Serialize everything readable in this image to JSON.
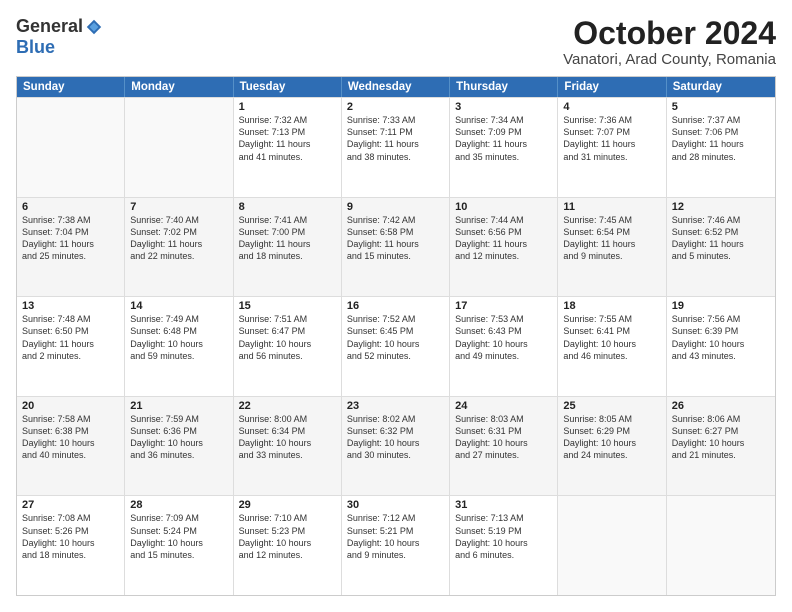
{
  "header": {
    "logo_general": "General",
    "logo_blue": "Blue",
    "month": "October 2024",
    "location": "Vanatori, Arad County, Romania"
  },
  "weekdays": [
    "Sunday",
    "Monday",
    "Tuesday",
    "Wednesday",
    "Thursday",
    "Friday",
    "Saturday"
  ],
  "rows": [
    [
      {
        "day": "",
        "lines": [],
        "empty": true
      },
      {
        "day": "",
        "lines": [],
        "empty": true
      },
      {
        "day": "1",
        "lines": [
          "Sunrise: 7:32 AM",
          "Sunset: 7:13 PM",
          "Daylight: 11 hours",
          "and 41 minutes."
        ]
      },
      {
        "day": "2",
        "lines": [
          "Sunrise: 7:33 AM",
          "Sunset: 7:11 PM",
          "Daylight: 11 hours",
          "and 38 minutes."
        ]
      },
      {
        "day": "3",
        "lines": [
          "Sunrise: 7:34 AM",
          "Sunset: 7:09 PM",
          "Daylight: 11 hours",
          "and 35 minutes."
        ]
      },
      {
        "day": "4",
        "lines": [
          "Sunrise: 7:36 AM",
          "Sunset: 7:07 PM",
          "Daylight: 11 hours",
          "and 31 minutes."
        ]
      },
      {
        "day": "5",
        "lines": [
          "Sunrise: 7:37 AM",
          "Sunset: 7:06 PM",
          "Daylight: 11 hours",
          "and 28 minutes."
        ]
      }
    ],
    [
      {
        "day": "6",
        "lines": [
          "Sunrise: 7:38 AM",
          "Sunset: 7:04 PM",
          "Daylight: 11 hours",
          "and 25 minutes."
        ]
      },
      {
        "day": "7",
        "lines": [
          "Sunrise: 7:40 AM",
          "Sunset: 7:02 PM",
          "Daylight: 11 hours",
          "and 22 minutes."
        ]
      },
      {
        "day": "8",
        "lines": [
          "Sunrise: 7:41 AM",
          "Sunset: 7:00 PM",
          "Daylight: 11 hours",
          "and 18 minutes."
        ]
      },
      {
        "day": "9",
        "lines": [
          "Sunrise: 7:42 AM",
          "Sunset: 6:58 PM",
          "Daylight: 11 hours",
          "and 15 minutes."
        ]
      },
      {
        "day": "10",
        "lines": [
          "Sunrise: 7:44 AM",
          "Sunset: 6:56 PM",
          "Daylight: 11 hours",
          "and 12 minutes."
        ]
      },
      {
        "day": "11",
        "lines": [
          "Sunrise: 7:45 AM",
          "Sunset: 6:54 PM",
          "Daylight: 11 hours",
          "and 9 minutes."
        ]
      },
      {
        "day": "12",
        "lines": [
          "Sunrise: 7:46 AM",
          "Sunset: 6:52 PM",
          "Daylight: 11 hours",
          "and 5 minutes."
        ]
      }
    ],
    [
      {
        "day": "13",
        "lines": [
          "Sunrise: 7:48 AM",
          "Sunset: 6:50 PM",
          "Daylight: 11 hours",
          "and 2 minutes."
        ]
      },
      {
        "day": "14",
        "lines": [
          "Sunrise: 7:49 AM",
          "Sunset: 6:48 PM",
          "Daylight: 10 hours",
          "and 59 minutes."
        ]
      },
      {
        "day": "15",
        "lines": [
          "Sunrise: 7:51 AM",
          "Sunset: 6:47 PM",
          "Daylight: 10 hours",
          "and 56 minutes."
        ]
      },
      {
        "day": "16",
        "lines": [
          "Sunrise: 7:52 AM",
          "Sunset: 6:45 PM",
          "Daylight: 10 hours",
          "and 52 minutes."
        ]
      },
      {
        "day": "17",
        "lines": [
          "Sunrise: 7:53 AM",
          "Sunset: 6:43 PM",
          "Daylight: 10 hours",
          "and 49 minutes."
        ]
      },
      {
        "day": "18",
        "lines": [
          "Sunrise: 7:55 AM",
          "Sunset: 6:41 PM",
          "Daylight: 10 hours",
          "and 46 minutes."
        ]
      },
      {
        "day": "19",
        "lines": [
          "Sunrise: 7:56 AM",
          "Sunset: 6:39 PM",
          "Daylight: 10 hours",
          "and 43 minutes."
        ]
      }
    ],
    [
      {
        "day": "20",
        "lines": [
          "Sunrise: 7:58 AM",
          "Sunset: 6:38 PM",
          "Daylight: 10 hours",
          "and 40 minutes."
        ]
      },
      {
        "day": "21",
        "lines": [
          "Sunrise: 7:59 AM",
          "Sunset: 6:36 PM",
          "Daylight: 10 hours",
          "and 36 minutes."
        ]
      },
      {
        "day": "22",
        "lines": [
          "Sunrise: 8:00 AM",
          "Sunset: 6:34 PM",
          "Daylight: 10 hours",
          "and 33 minutes."
        ]
      },
      {
        "day": "23",
        "lines": [
          "Sunrise: 8:02 AM",
          "Sunset: 6:32 PM",
          "Daylight: 10 hours",
          "and 30 minutes."
        ]
      },
      {
        "day": "24",
        "lines": [
          "Sunrise: 8:03 AM",
          "Sunset: 6:31 PM",
          "Daylight: 10 hours",
          "and 27 minutes."
        ]
      },
      {
        "day": "25",
        "lines": [
          "Sunrise: 8:05 AM",
          "Sunset: 6:29 PM",
          "Daylight: 10 hours",
          "and 24 minutes."
        ]
      },
      {
        "day": "26",
        "lines": [
          "Sunrise: 8:06 AM",
          "Sunset: 6:27 PM",
          "Daylight: 10 hours",
          "and 21 minutes."
        ]
      }
    ],
    [
      {
        "day": "27",
        "lines": [
          "Sunrise: 7:08 AM",
          "Sunset: 5:26 PM",
          "Daylight: 10 hours",
          "and 18 minutes."
        ]
      },
      {
        "day": "28",
        "lines": [
          "Sunrise: 7:09 AM",
          "Sunset: 5:24 PM",
          "Daylight: 10 hours",
          "and 15 minutes."
        ]
      },
      {
        "day": "29",
        "lines": [
          "Sunrise: 7:10 AM",
          "Sunset: 5:23 PM",
          "Daylight: 10 hours",
          "and 12 minutes."
        ]
      },
      {
        "day": "30",
        "lines": [
          "Sunrise: 7:12 AM",
          "Sunset: 5:21 PM",
          "Daylight: 10 hours",
          "and 9 minutes."
        ]
      },
      {
        "day": "31",
        "lines": [
          "Sunrise: 7:13 AM",
          "Sunset: 5:19 PM",
          "Daylight: 10 hours",
          "and 6 minutes."
        ]
      },
      {
        "day": "",
        "lines": [],
        "empty": true
      },
      {
        "day": "",
        "lines": [],
        "empty": true
      }
    ]
  ]
}
